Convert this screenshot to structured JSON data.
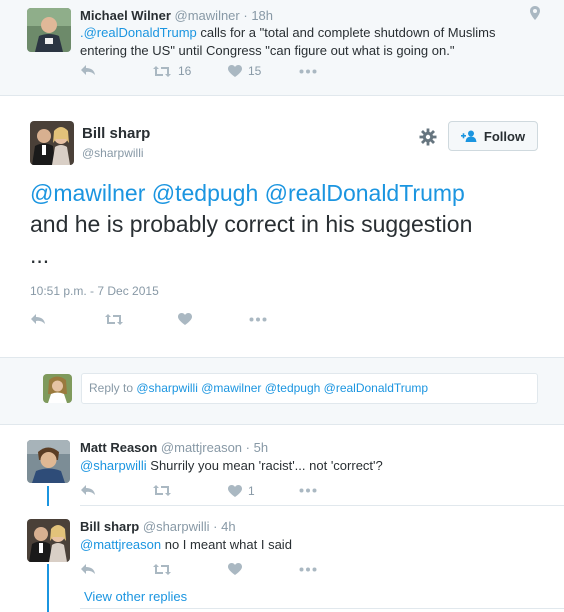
{
  "top_tweet": {
    "name": "Michael Wilner",
    "handle": "@mawilner",
    "time": "· 18h",
    "mention": ".@realDonaldTrump",
    "text_rest": " calls for a \"total and complete shutdown of Muslims",
    "text_line2": "entering the US\" until Congress \"can figure out what is going on.\"",
    "retweets": "16",
    "likes": "15"
  },
  "main_tweet": {
    "name": "Bill sharp",
    "handle": "@sharpwilli",
    "follow_label": "Follow",
    "mentions": "@mawilner @tedpugh @realDonaldTrump",
    "text_line2": "and he is probably correct in his suggestion",
    "text_line3": "...",
    "timestamp": "10:51 p.m. - 7 Dec 2015"
  },
  "reply_box": {
    "prefix": "Reply to ",
    "mentions": "@sharpwilli @mawilner @tedpugh @realDonaldTrump"
  },
  "replies": [
    {
      "name": "Matt Reason",
      "handle": "@mattjreason",
      "time": "· 5h",
      "mention": "@sharpwilli",
      "text": " Shurrily you mean 'racist'... not 'correct'?",
      "likes": "1"
    },
    {
      "name": "Bill sharp",
      "handle": "@sharpwilli",
      "time": "· 4h",
      "mention": "@mattjreason",
      "text": " no I meant what I said"
    }
  ],
  "view_other_replies": "View other replies",
  "colors": {
    "link": "#1b95e0",
    "muted": "#8899a6",
    "text": "#292f33",
    "band": "#f5f8fa"
  }
}
